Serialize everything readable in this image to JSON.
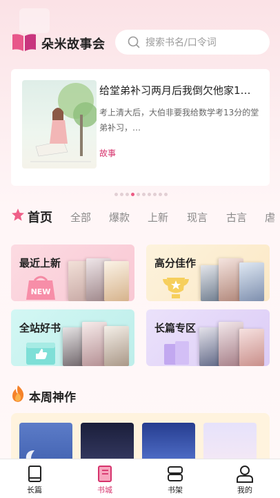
{
  "header": {
    "app_title": "朵米故事会",
    "search_placeholder": "搜索书名/口令词"
  },
  "feature": {
    "title": "给堂弟补习两月后我倒欠他家1…",
    "description": "考上清大后，大伯非要我给数学考13分的堂弟补习，…",
    "tag": "故事"
  },
  "carousel": {
    "count": 10,
    "active_index": 3
  },
  "tabs": [
    "首页",
    "全部",
    "爆款",
    "上新",
    "现言",
    "古言",
    "虐"
  ],
  "categories": [
    {
      "label": "最近上新",
      "icon_text": "NEW"
    },
    {
      "label": "高分佳作"
    },
    {
      "label": "全站好书"
    },
    {
      "label": "长篇专区"
    }
  ],
  "weekly": {
    "title": "本周神作"
  },
  "bottom_nav": [
    {
      "label": "长篇",
      "icon": "book-icon"
    },
    {
      "label": "书城",
      "icon": "bookstore-icon"
    },
    {
      "label": "书架",
      "icon": "bookshelf-icon"
    },
    {
      "label": "我的",
      "icon": "profile-icon"
    }
  ],
  "colors": {
    "accent": "#d6336c",
    "logo": "#e04f7e",
    "pink_card": "#fbd3dc",
    "gold_card": "#fcefd4",
    "teal_card": "#c5f1ee",
    "purple_card": "#e7dcf8"
  }
}
